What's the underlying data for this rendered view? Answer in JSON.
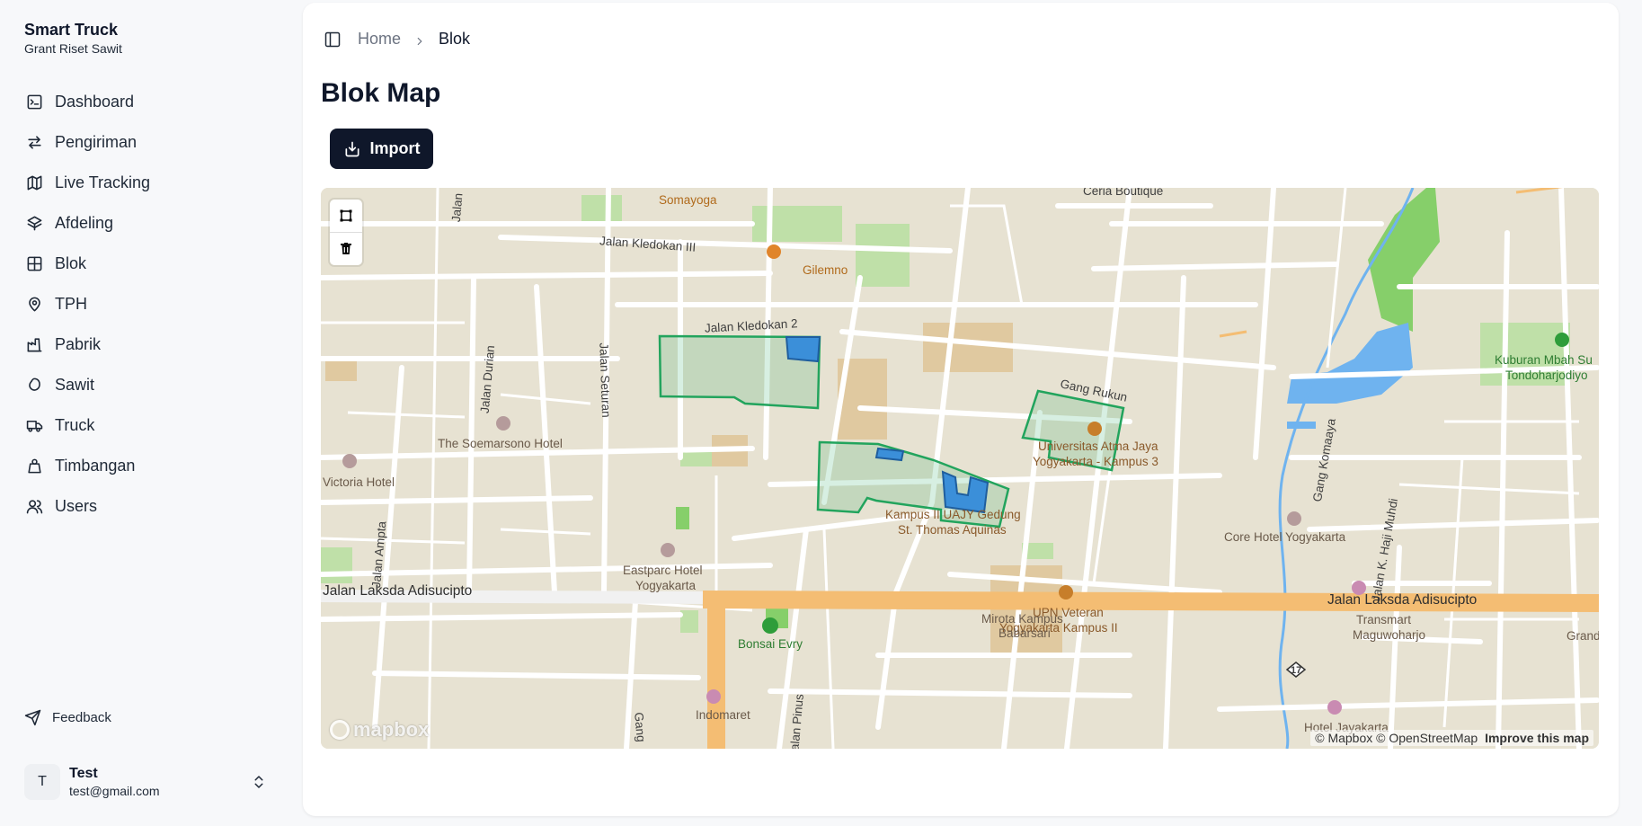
{
  "app": {
    "title": "Smart Truck",
    "subtitle": "Grant Riset Sawit"
  },
  "sidebar": {
    "items": [
      {
        "label": "Dashboard",
        "icon": "dashboard-icon"
      },
      {
        "label": "Pengiriman",
        "icon": "arrows-left-right-icon"
      },
      {
        "label": "Live Tracking",
        "icon": "map-icon"
      },
      {
        "label": "Afdeling",
        "icon": "layers-icon"
      },
      {
        "label": "Blok",
        "icon": "grid-icon"
      },
      {
        "label": "TPH",
        "icon": "map-pin-icon"
      },
      {
        "label": "Pabrik",
        "icon": "factory-icon"
      },
      {
        "label": "Sawit",
        "icon": "bean-icon"
      },
      {
        "label": "Truck",
        "icon": "truck-icon"
      },
      {
        "label": "Timbangan",
        "icon": "weight-icon"
      },
      {
        "label": "Users",
        "icon": "users-icon"
      }
    ],
    "feedback_label": "Feedback"
  },
  "user": {
    "initial": "T",
    "name": "Test",
    "email": "test@gmail.com"
  },
  "breadcrumb": {
    "home": "Home",
    "current": "Blok"
  },
  "page": {
    "title": "Blok Map",
    "import_label": "Import"
  },
  "map": {
    "attribution": "© Mapbox © OpenStreetMap",
    "improve": "Improve this map",
    "logo": "mapbox",
    "labels": {
      "somayoga": "Somayoga",
      "ceria": "Ceria Boutique",
      "kledokan3": "Jalan Kledokan III",
      "gilemno": "Gilemno",
      "kledokan2": "Jalan Kledokan 2",
      "jalan_top": "Jalan",
      "durian": "Jalan Durian",
      "seturan": "Jalan Seturan",
      "soemarsono": "The Soemarsono Hotel",
      "victoria": "Victoria Hotel",
      "gang_rukun": "Gang Rukun",
      "uajy1": "Universitas Atma Jaya",
      "uajy2": "Yogyakarta - Kampus 3",
      "kampus2_1": "Kampus II UAJY Gedung",
      "kampus2_2": "St. Thomas Aquinas",
      "eastparc1": "Eastparc Hotel",
      "eastparc2": "Yogyakarta",
      "ampta": "Jalan Ampta",
      "bonsai": "Bonsai Evry",
      "upn1": "UPN Veteran",
      "upn2": "Yogyakarta Kampus II",
      "core": "Core Hotel Yogyakarta",
      "komaaya": "Gang Komaaya",
      "haji_muhdi": "Jalan K. Haji Muhdi",
      "transmart1": "Transmart",
      "transmart2": "Maguwoharjo",
      "grand": "Grand",
      "kuburan1": "Kuburan Mbah Su",
      "kuburan2": "Tondoharjodiyo",
      "adisucipto_left": "Jalan Laksda Adisucipto",
      "adisucipto_right": "Jalan Laksda Adisucipto",
      "mirota1": "Mirota Kampus",
      "mirota2": "Babarsari",
      "indomaret": "Indomaret",
      "pinus": "Jalan Pinus",
      "gang_bottom": "Gang",
      "route17": "17",
      "hotel_bottom": "Hotel Jayakarta"
    }
  },
  "colors": {
    "accent": "#0f172a",
    "polygon_green": "#22a45d",
    "polygon_blue": "#3b8fd9",
    "map_bg": "#e7e2d2",
    "highway": "#f4bd73",
    "water": "#6fb3ef",
    "park": "#a8d98e"
  }
}
